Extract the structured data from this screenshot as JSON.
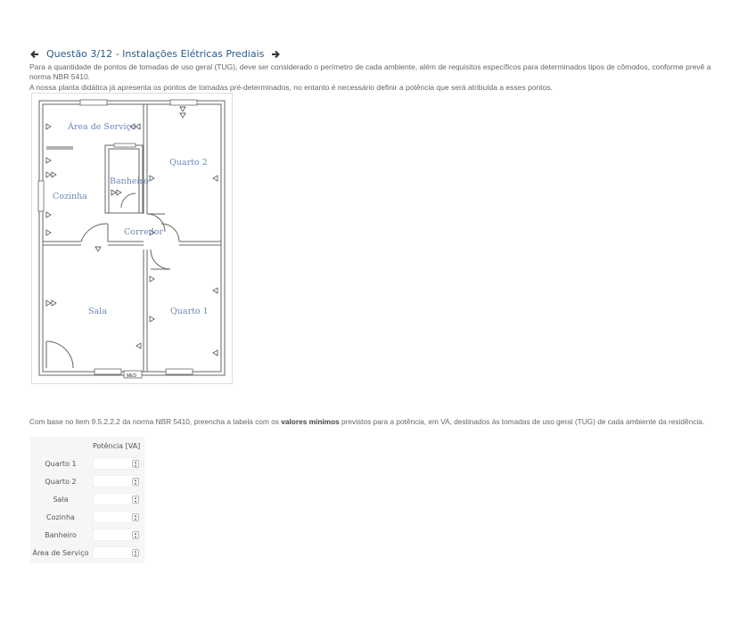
{
  "header": {
    "title": "Questão 3/12 - Instalações Elétricas Prediais",
    "prev_icon": "arrow-left-icon",
    "next_icon": "arrow-right-icon",
    "link_color": "#2b5b8a"
  },
  "intro": {
    "line1": "Para a quantidade de pontos de tomadas de uso geral (TUG), deve ser considerado o perímetro de cada ambiente, além de requisitos específicos para determinados tipos de cômodos, conforme prevê a norma NBR 5410.",
    "line2": "A nossa planta didática já apresenta os pontos de tomadas pré-determinados, no entanto é necessário definir a potência que será atribuída a esses pontos."
  },
  "plan": {
    "rooms": {
      "area_servico": "Área de Serviço",
      "quarto2": "Quarto 2",
      "banheiro": "Banheiro",
      "cozinha": "Cozinha",
      "corredor": "Corredor",
      "sala": "Sala",
      "quarto1": "Quarto 1"
    },
    "meter_label": "MED"
  },
  "question": {
    "part1": "Com base no item 9.5.2.2.2 da norma NBR 5410, preencha a tabela com os ",
    "bold": "valores mínimos",
    "part2": " previstos para a potência, em VA, destinados às tomadas de uso geral (TUG) de cada ambiente da residência."
  },
  "table": {
    "header": "Potência [VA]",
    "rows": [
      {
        "label": "Quarto 1",
        "value": ""
      },
      {
        "label": "Quarto 2",
        "value": ""
      },
      {
        "label": "Sala",
        "value": ""
      },
      {
        "label": "Cozinha",
        "value": ""
      },
      {
        "label": "Banheiro",
        "value": ""
      },
      {
        "label": "Área de Serviço",
        "value": ""
      }
    ]
  }
}
